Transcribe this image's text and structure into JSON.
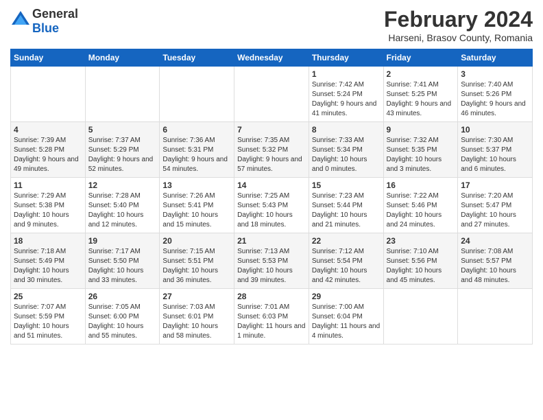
{
  "header": {
    "logo_general": "General",
    "logo_blue": "Blue",
    "month_title": "February 2024",
    "location": "Harseni, Brasov County, Romania"
  },
  "weekdays": [
    "Sunday",
    "Monday",
    "Tuesday",
    "Wednesday",
    "Thursday",
    "Friday",
    "Saturday"
  ],
  "weeks": [
    [
      {
        "day": "",
        "sunrise": "",
        "sunset": "",
        "daylight": "",
        "empty": true
      },
      {
        "day": "",
        "sunrise": "",
        "sunset": "",
        "daylight": "",
        "empty": true
      },
      {
        "day": "",
        "sunrise": "",
        "sunset": "",
        "daylight": "",
        "empty": true
      },
      {
        "day": "",
        "sunrise": "",
        "sunset": "",
        "daylight": "",
        "empty": true
      },
      {
        "day": "1",
        "sunrise": "Sunrise: 7:42 AM",
        "sunset": "Sunset: 5:24 PM",
        "daylight": "Daylight: 9 hours and 41 minutes.",
        "empty": false
      },
      {
        "day": "2",
        "sunrise": "Sunrise: 7:41 AM",
        "sunset": "Sunset: 5:25 PM",
        "daylight": "Daylight: 9 hours and 43 minutes.",
        "empty": false
      },
      {
        "day": "3",
        "sunrise": "Sunrise: 7:40 AM",
        "sunset": "Sunset: 5:26 PM",
        "daylight": "Daylight: 9 hours and 46 minutes.",
        "empty": false
      }
    ],
    [
      {
        "day": "4",
        "sunrise": "Sunrise: 7:39 AM",
        "sunset": "Sunset: 5:28 PM",
        "daylight": "Daylight: 9 hours and 49 minutes.",
        "empty": false
      },
      {
        "day": "5",
        "sunrise": "Sunrise: 7:37 AM",
        "sunset": "Sunset: 5:29 PM",
        "daylight": "Daylight: 9 hours and 52 minutes.",
        "empty": false
      },
      {
        "day": "6",
        "sunrise": "Sunrise: 7:36 AM",
        "sunset": "Sunset: 5:31 PM",
        "daylight": "Daylight: 9 hours and 54 minutes.",
        "empty": false
      },
      {
        "day": "7",
        "sunrise": "Sunrise: 7:35 AM",
        "sunset": "Sunset: 5:32 PM",
        "daylight": "Daylight: 9 hours and 57 minutes.",
        "empty": false
      },
      {
        "day": "8",
        "sunrise": "Sunrise: 7:33 AM",
        "sunset": "Sunset: 5:34 PM",
        "daylight": "Daylight: 10 hours and 0 minutes.",
        "empty": false
      },
      {
        "day": "9",
        "sunrise": "Sunrise: 7:32 AM",
        "sunset": "Sunset: 5:35 PM",
        "daylight": "Daylight: 10 hours and 3 minutes.",
        "empty": false
      },
      {
        "day": "10",
        "sunrise": "Sunrise: 7:30 AM",
        "sunset": "Sunset: 5:37 PM",
        "daylight": "Daylight: 10 hours and 6 minutes.",
        "empty": false
      }
    ],
    [
      {
        "day": "11",
        "sunrise": "Sunrise: 7:29 AM",
        "sunset": "Sunset: 5:38 PM",
        "daylight": "Daylight: 10 hours and 9 minutes.",
        "empty": false
      },
      {
        "day": "12",
        "sunrise": "Sunrise: 7:28 AM",
        "sunset": "Sunset: 5:40 PM",
        "daylight": "Daylight: 10 hours and 12 minutes.",
        "empty": false
      },
      {
        "day": "13",
        "sunrise": "Sunrise: 7:26 AM",
        "sunset": "Sunset: 5:41 PM",
        "daylight": "Daylight: 10 hours and 15 minutes.",
        "empty": false
      },
      {
        "day": "14",
        "sunrise": "Sunrise: 7:25 AM",
        "sunset": "Sunset: 5:43 PM",
        "daylight": "Daylight: 10 hours and 18 minutes.",
        "empty": false
      },
      {
        "day": "15",
        "sunrise": "Sunrise: 7:23 AM",
        "sunset": "Sunset: 5:44 PM",
        "daylight": "Daylight: 10 hours and 21 minutes.",
        "empty": false
      },
      {
        "day": "16",
        "sunrise": "Sunrise: 7:22 AM",
        "sunset": "Sunset: 5:46 PM",
        "daylight": "Daylight: 10 hours and 24 minutes.",
        "empty": false
      },
      {
        "day": "17",
        "sunrise": "Sunrise: 7:20 AM",
        "sunset": "Sunset: 5:47 PM",
        "daylight": "Daylight: 10 hours and 27 minutes.",
        "empty": false
      }
    ],
    [
      {
        "day": "18",
        "sunrise": "Sunrise: 7:18 AM",
        "sunset": "Sunset: 5:49 PM",
        "daylight": "Daylight: 10 hours and 30 minutes.",
        "empty": false
      },
      {
        "day": "19",
        "sunrise": "Sunrise: 7:17 AM",
        "sunset": "Sunset: 5:50 PM",
        "daylight": "Daylight: 10 hours and 33 minutes.",
        "empty": false
      },
      {
        "day": "20",
        "sunrise": "Sunrise: 7:15 AM",
        "sunset": "Sunset: 5:51 PM",
        "daylight": "Daylight: 10 hours and 36 minutes.",
        "empty": false
      },
      {
        "day": "21",
        "sunrise": "Sunrise: 7:13 AM",
        "sunset": "Sunset: 5:53 PM",
        "daylight": "Daylight: 10 hours and 39 minutes.",
        "empty": false
      },
      {
        "day": "22",
        "sunrise": "Sunrise: 7:12 AM",
        "sunset": "Sunset: 5:54 PM",
        "daylight": "Daylight: 10 hours and 42 minutes.",
        "empty": false
      },
      {
        "day": "23",
        "sunrise": "Sunrise: 7:10 AM",
        "sunset": "Sunset: 5:56 PM",
        "daylight": "Daylight: 10 hours and 45 minutes.",
        "empty": false
      },
      {
        "day": "24",
        "sunrise": "Sunrise: 7:08 AM",
        "sunset": "Sunset: 5:57 PM",
        "daylight": "Daylight: 10 hours and 48 minutes.",
        "empty": false
      }
    ],
    [
      {
        "day": "25",
        "sunrise": "Sunrise: 7:07 AM",
        "sunset": "Sunset: 5:59 PM",
        "daylight": "Daylight: 10 hours and 51 minutes.",
        "empty": false
      },
      {
        "day": "26",
        "sunrise": "Sunrise: 7:05 AM",
        "sunset": "Sunset: 6:00 PM",
        "daylight": "Daylight: 10 hours and 55 minutes.",
        "empty": false
      },
      {
        "day": "27",
        "sunrise": "Sunrise: 7:03 AM",
        "sunset": "Sunset: 6:01 PM",
        "daylight": "Daylight: 10 hours and 58 minutes.",
        "empty": false
      },
      {
        "day": "28",
        "sunrise": "Sunrise: 7:01 AM",
        "sunset": "Sunset: 6:03 PM",
        "daylight": "Daylight: 11 hours and 1 minute.",
        "empty": false
      },
      {
        "day": "29",
        "sunrise": "Sunrise: 7:00 AM",
        "sunset": "Sunset: 6:04 PM",
        "daylight": "Daylight: 11 hours and 4 minutes.",
        "empty": false
      },
      {
        "day": "",
        "sunrise": "",
        "sunset": "",
        "daylight": "",
        "empty": true
      },
      {
        "day": "",
        "sunrise": "",
        "sunset": "",
        "daylight": "",
        "empty": true
      }
    ]
  ]
}
